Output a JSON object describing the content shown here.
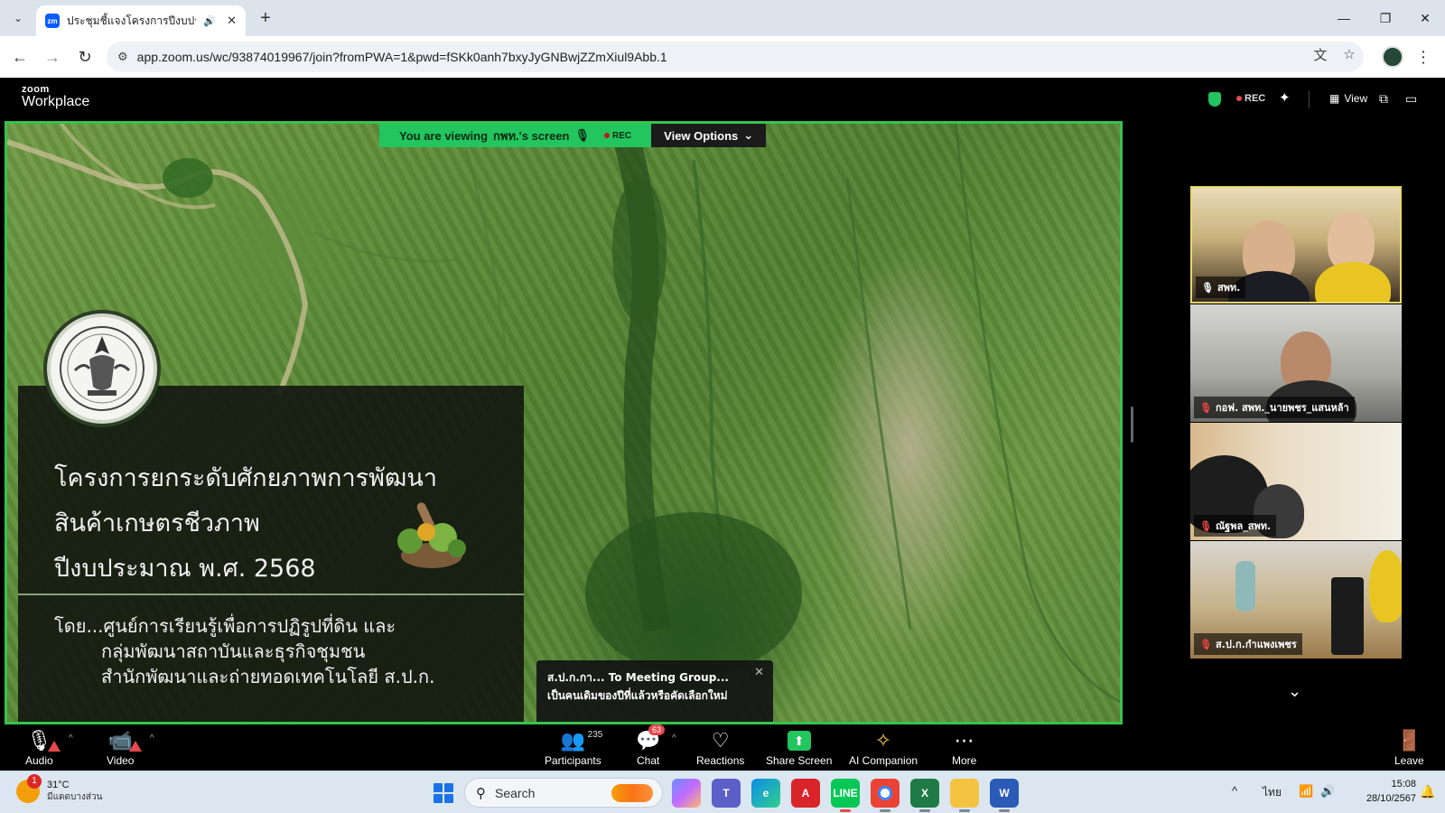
{
  "browser": {
    "tab_title": "ประชุมชี้แจงโครงการปีงบประมาณ",
    "tab_favicon": "zm",
    "url": "app.zoom.us/wc/93874019967/join?fromPWA=1&pwd=fSKk0anh7bxyJyGNBwjZZmXiul9Abb.1"
  },
  "zoom_header": {
    "brand_small": "zoom",
    "brand_large": "Workplace",
    "rec_label": "REC",
    "view_label": "View"
  },
  "share_banner": {
    "viewing_prefix": "You are viewing",
    "presenter": "กพท.'s screen",
    "rec_label": "REC",
    "view_options": "View Options"
  },
  "slide": {
    "title_line1": "โครงการยกระดับศักยภาพการพัฒนา",
    "title_line2": "สินค้าเกษตรชีวภาพ",
    "title_line3": "ปีงบประมาณ พ.ศ. 2568",
    "by_line1": "โดย...ศูนย์การเรียนรู้เพื่อการปฏิรูปที่ดิน และ",
    "by_line2": "กลุ่มพัฒนาสถาบันและธุรกิจชุมชน",
    "by_line3": "สำนักพัฒนาและถ่ายทอดเทคโนโลยี  ส.ป.ก."
  },
  "chat_toast": {
    "header": "ส.ป.ก.กา... To Meeting Group...",
    "message": "เป็นคนเดิมของปีที่แล้วหรือคัดเลือกใหม่"
  },
  "gallery": [
    {
      "name": "สพท.",
      "active": true,
      "muted": false
    },
    {
      "name": "กอฟ. สพท._นายพชร_แสนหล้า",
      "active": false,
      "muted": true
    },
    {
      "name": "ณัฐพล_สพท.",
      "active": false,
      "muted": true
    },
    {
      "name": "ส.ป.ก.กำแพงเพชร",
      "active": false,
      "muted": true
    }
  ],
  "toolbar": {
    "audio": "Audio",
    "video": "Video",
    "participants": "Participants",
    "participants_count": "235",
    "chat": "Chat",
    "chat_badge": "63",
    "reactions": "Reactions",
    "share_screen": "Share Screen",
    "ai_companion": "AI Companion",
    "more": "More",
    "leave": "Leave"
  },
  "taskbar": {
    "weather_badge": "1",
    "temperature": "31°C",
    "weather_desc": "มีแดดบางส่วน",
    "search_label": "Search",
    "language": "ไทย",
    "time": "15:08",
    "date": "28/10/2567"
  },
  "colors": {
    "share_border": "#35c44c",
    "zoom_green": "#22c55e",
    "alert_red": "#e5484d",
    "zoom_blue": "#0b5cff"
  }
}
